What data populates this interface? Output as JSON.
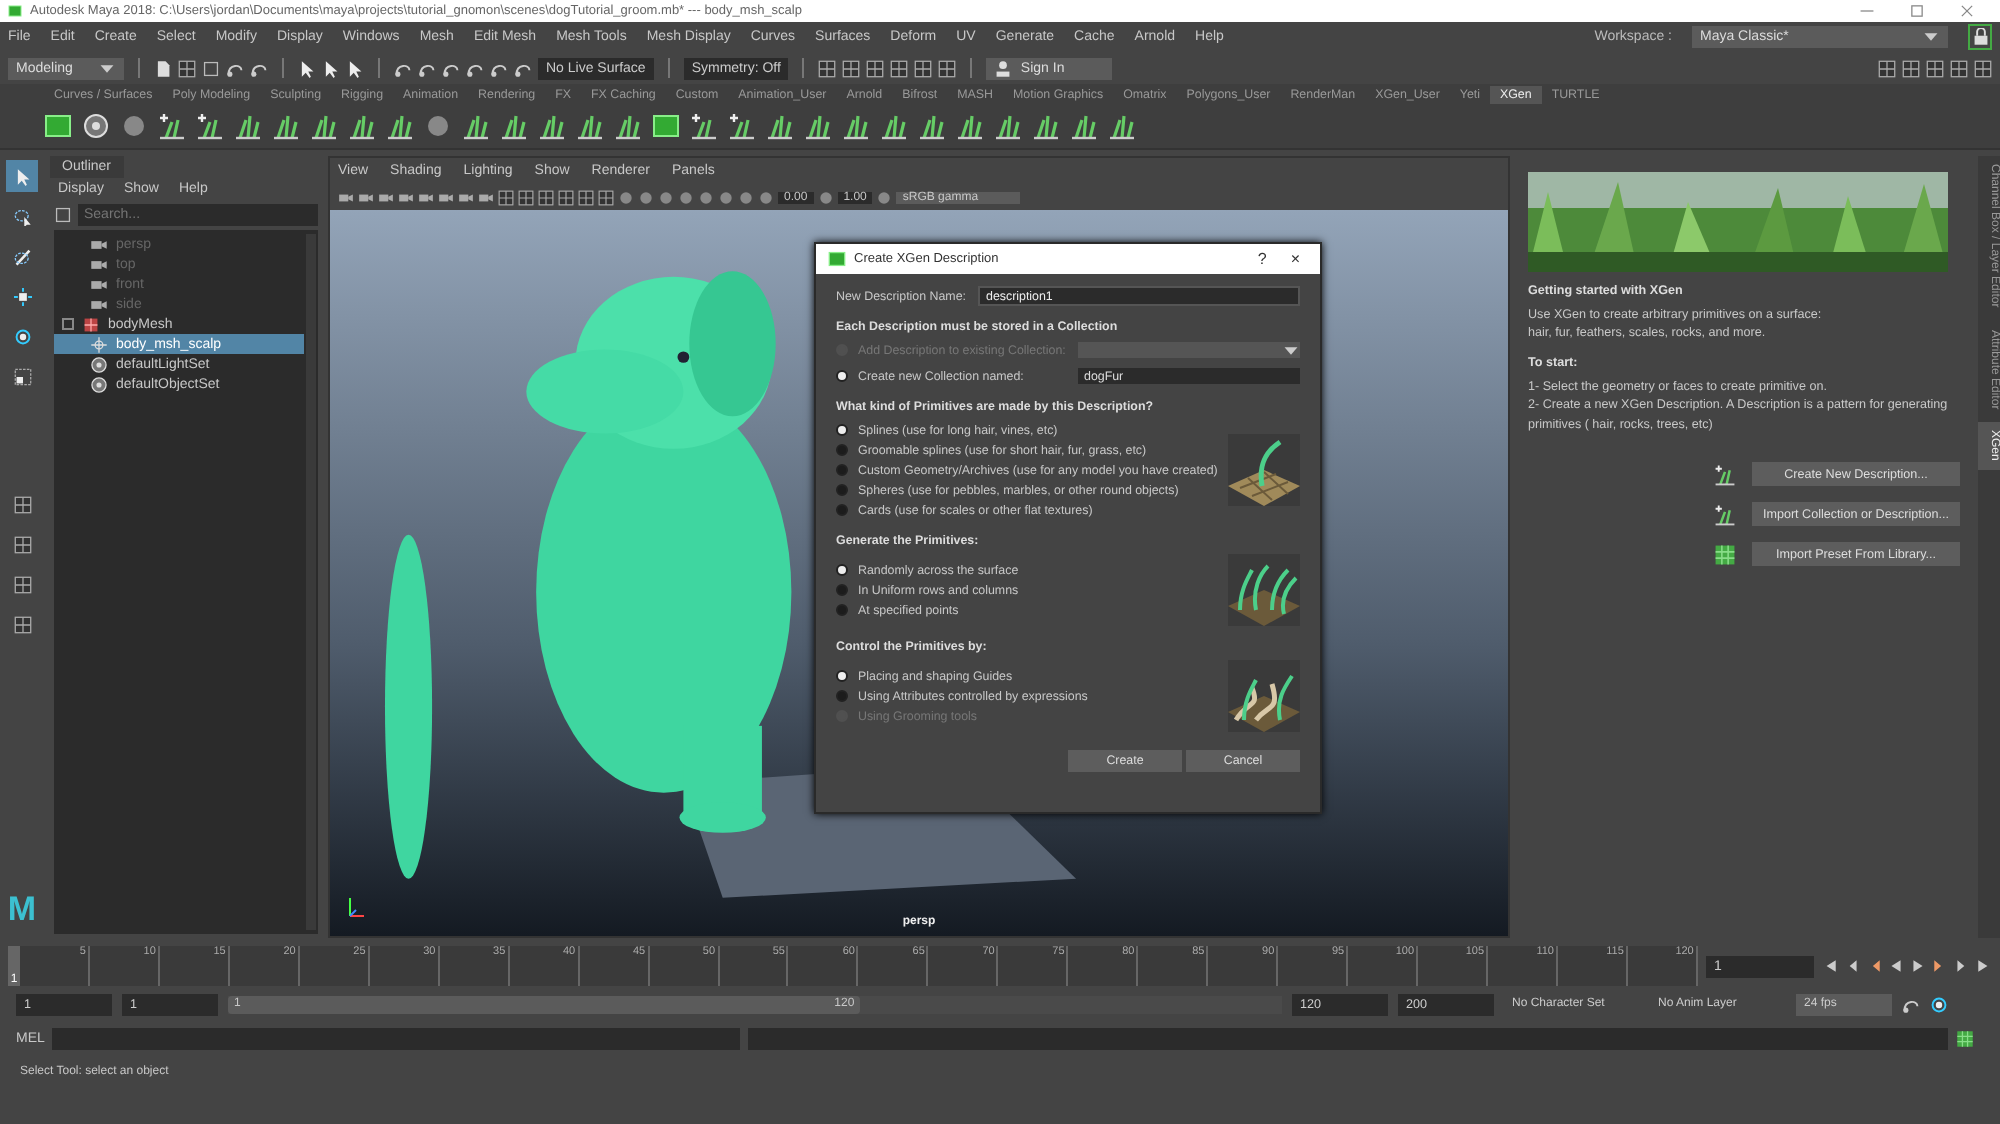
{
  "title_bar": {
    "title": "Autodesk Maya 2018: C:\\Users\\jordan\\Documents\\maya\\projects\\tutorial_gnomon\\scenes\\dogTutorial_groom.mb*  ---  body_msh_scalp"
  },
  "menu_bar": {
    "items": [
      "File",
      "Edit",
      "Create",
      "Select",
      "Modify",
      "Display",
      "Windows",
      "Mesh",
      "Edit Mesh",
      "Mesh Tools",
      "Mesh Display",
      "Curves",
      "Surfaces",
      "Deform",
      "UV",
      "Generate",
      "Cache",
      "Arnold",
      "Help"
    ],
    "workspace_label": "Workspace :",
    "workspace": "Maya Classic*"
  },
  "status_line": {
    "mode": "Modeling",
    "live_surface": "No Live Surface",
    "symmetry": "Symmetry: Off",
    "sign_in": "Sign In"
  },
  "shelf_tabs": [
    {
      "label": "Curves / Surfaces",
      "selected": false
    },
    {
      "label": "Poly Modeling",
      "selected": false
    },
    {
      "label": "Sculpting",
      "selected": false
    },
    {
      "label": "Rigging",
      "selected": false
    },
    {
      "label": "Animation",
      "selected": false
    },
    {
      "label": "Rendering",
      "selected": false
    },
    {
      "label": "FX",
      "selected": false
    },
    {
      "label": "FX Caching",
      "selected": false
    },
    {
      "label": "Custom",
      "selected": false
    },
    {
      "label": "Animation_User",
      "selected": false
    },
    {
      "label": "Arnold",
      "selected": false
    },
    {
      "label": "Bifrost",
      "selected": false
    },
    {
      "label": "MASH",
      "selected": false
    },
    {
      "label": "Motion Graphics",
      "selected": false
    },
    {
      "label": "Omatrix",
      "selected": false
    },
    {
      "label": "Polygons_User",
      "selected": false
    },
    {
      "label": "RenderMan",
      "selected": false
    },
    {
      "label": "XGen_User",
      "selected": false
    },
    {
      "label": "Yeti",
      "selected": false
    },
    {
      "label": "XGen",
      "selected": true
    },
    {
      "label": "TURTLE",
      "selected": false
    }
  ],
  "outliner": {
    "title": "Outliner",
    "menu": [
      "Display",
      "Show",
      "Help"
    ],
    "search": {
      "placeholder": "Search..."
    },
    "items": [
      {
        "label": "persp",
        "kind": "camera",
        "dimmed": true,
        "selected": false
      },
      {
        "label": "top",
        "kind": "camera",
        "dimmed": true,
        "selected": false
      },
      {
        "label": "front",
        "kind": "camera",
        "dimmed": true,
        "selected": false
      },
      {
        "label": "side",
        "kind": "camera",
        "dimmed": true,
        "selected": false
      },
      {
        "label": "bodyMesh",
        "kind": "mesh",
        "dimmed": false,
        "selected": false
      },
      {
        "label": "body_msh_scalp",
        "kind": "locator",
        "dimmed": false,
        "selected": true
      },
      {
        "label": "defaultLightSet",
        "kind": "set",
        "dimmed": false,
        "selected": false
      },
      {
        "label": "defaultObjectSet",
        "kind": "set",
        "dimmed": false,
        "selected": false
      }
    ]
  },
  "viewport": {
    "menu": [
      "View",
      "Shading",
      "Lighting",
      "Show",
      "Renderer",
      "Panels"
    ],
    "exposure": "0.00",
    "gamma": "1.00",
    "color_space": "sRGB gamma",
    "camera": "persp"
  },
  "dialog": {
    "title": "Create XGen Description",
    "help": "?",
    "close": "×",
    "name_label": "New Description Name:",
    "name_value": "description1",
    "collection_heading": "Each Description must be stored in a Collection",
    "collection_options": [
      {
        "label": "Add Description to existing Collection:",
        "selected": false,
        "disabled": true
      },
      {
        "label": "Create new Collection named:",
        "selected": true,
        "disabled": false
      }
    ],
    "collection_name": "dogFur",
    "groups": [
      {
        "heading": "What kind of Primitives are made by this Description?",
        "options": [
          {
            "label": "Splines (use for long hair, vines, etc)",
            "selected": true,
            "disabled": false
          },
          {
            "label": "Groomable splines (use for short hair, fur, grass, etc)",
            "selected": false,
            "disabled": false
          },
          {
            "label": "Custom Geometry/Archives (use for any model you have created)",
            "selected": false,
            "disabled": false
          },
          {
            "label": "Spheres (use for pebbles, marbles, or other round objects)",
            "selected": false,
            "disabled": false
          },
          {
            "label": "Cards (use for scales or other flat textures)",
            "selected": false,
            "disabled": false
          }
        ]
      },
      {
        "heading": "Generate the Primitives:",
        "options": [
          {
            "label": "Randomly across the surface",
            "selected": true,
            "disabled": false
          },
          {
            "label": "In Uniform rows and columns",
            "selected": false,
            "disabled": false
          },
          {
            "label": "At specified points",
            "selected": false,
            "disabled": false
          }
        ]
      },
      {
        "heading": "Control the Primitives by:",
        "options": [
          {
            "label": "Placing and shaping Guides",
            "selected": true,
            "disabled": false
          },
          {
            "label": "Using Attributes controlled by expressions",
            "selected": false,
            "disabled": false
          },
          {
            "label": "Using Grooming tools",
            "selected": false,
            "disabled": true
          }
        ]
      }
    ],
    "buttons": [
      "Create",
      "Cancel"
    ]
  },
  "xgen_panel": {
    "heading": "Getting started with XGen",
    "intro": [
      "Use XGen to create arbitrary primitives on a surface:",
      "hair, fur, feathers, scales, rocks, and more."
    ],
    "steps_heading": "To start:",
    "steps": [
      "1- Select the geometry or faces to create primitive on.",
      "2- Create a new XGen Description. A Description is a pattern for generating primitives ( hair, rocks, trees, etc)"
    ],
    "actions": [
      {
        "label": "Create New Description...",
        "kind": "grass"
      },
      {
        "label": "Import Collection or Description...",
        "kind": "grass"
      },
      {
        "label": "Import Preset From Library...",
        "kind": "grid"
      }
    ]
  },
  "side_tabs": [
    {
      "label": "Channel Box / Layer Editor",
      "selected": false
    },
    {
      "label": "Attribute Editor",
      "selected": false
    },
    {
      "label": "XGen",
      "selected": true
    }
  ],
  "logo": "M",
  "time_slider": {
    "current": "1",
    "ticks": [
      "5",
      "10",
      "15",
      "20",
      "25",
      "30",
      "35",
      "40",
      "45",
      "50",
      "55",
      "60",
      "65",
      "70",
      "75",
      "80",
      "85",
      "90",
      "95",
      "100",
      "105",
      "110",
      "115",
      "120"
    ],
    "frame_field": "1"
  },
  "range_slider": {
    "start": "1",
    "inner_start": "1",
    "level": 0.6,
    "bar_start": "1",
    "bar_end": "120",
    "inner_end": "120",
    "end": "200",
    "character_set": "No Character Set",
    "anim_layer": "No Anim Layer",
    "fps": "24 fps"
  },
  "command_line": {
    "language": "MEL"
  },
  "help_line": "Select Tool: select an object"
}
